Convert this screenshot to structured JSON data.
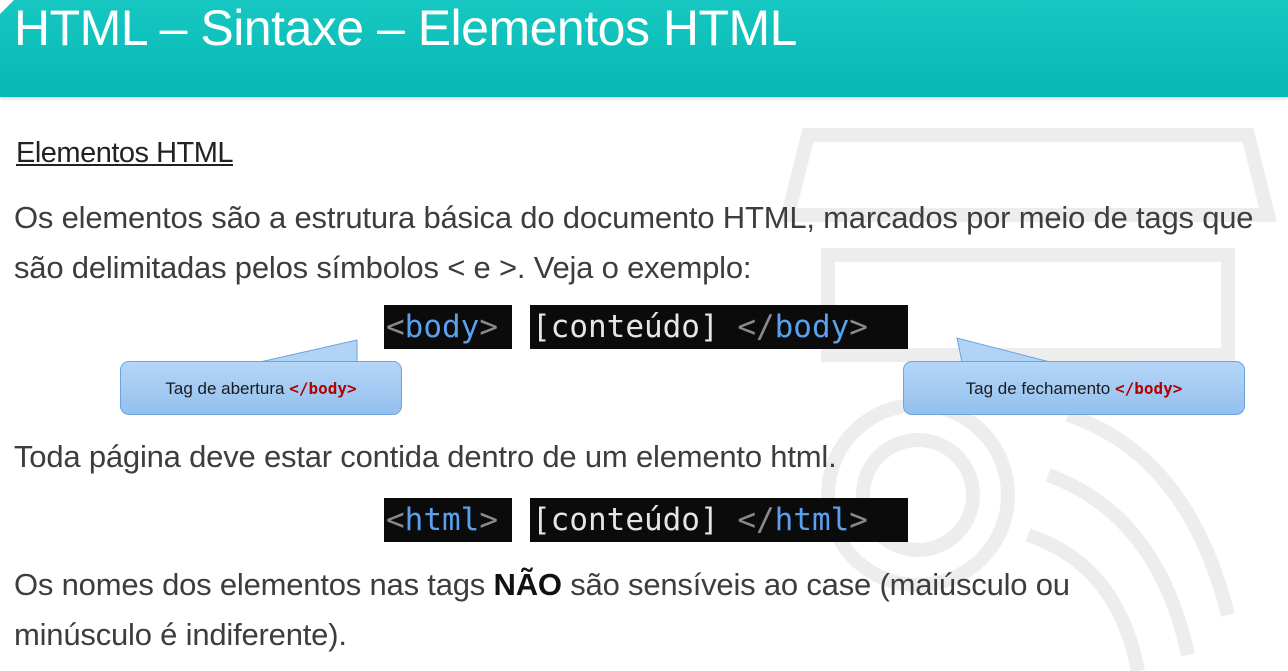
{
  "slide_title": "HTML – Sintaxe – Elementos HTML",
  "section_heading": "Elementos HTML",
  "paragraph1": "Os elementos são a estrutura básica do documento HTML, marcados por meio de tags que são delimitadas pelos símbolos < e >. Veja o exemplo:",
  "example_body": {
    "open_lt": "<",
    "open_name": "body",
    "open_gt": ">",
    "content": "[conteúdo] ",
    "close_lt": "</",
    "close_name": "body",
    "close_gt": ">"
  },
  "callout_open": {
    "text": "Tag de abertura ",
    "code": "</body>"
  },
  "callout_close": {
    "text": "Tag de fechamento ",
    "code": "</body>"
  },
  "paragraph2": "Toda página deve estar contida dentro de um elemento html.",
  "example_html": {
    "open_lt": "<",
    "open_name": "html",
    "open_gt": ">",
    "content": "[conteúdo] ",
    "close_lt": "</",
    "close_name": "html",
    "close_gt": ">"
  },
  "paragraph3": {
    "before": "Os nomes dos elementos nas tags ",
    "strong": "NÃO",
    "after": " são sensíveis ao case (maiúsculo ou minúsculo é indiferente)."
  },
  "colors": {
    "header": "#0fc0bb",
    "tag_name": "#5aa0ee",
    "callout_code": "#b30000",
    "callout_fill": "#a4cbf3"
  }
}
